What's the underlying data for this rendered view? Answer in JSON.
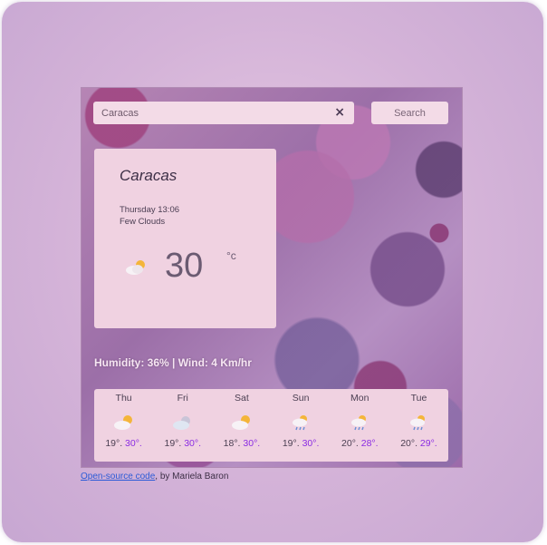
{
  "search": {
    "value": "Caracas",
    "clear_label": "×",
    "button_label": "Search"
  },
  "current": {
    "city": "Caracas",
    "datetime": "Thursday 13:06",
    "description": "Few Clouds",
    "icon": "few-clouds-icon",
    "temperature": "30",
    "unit": "°c"
  },
  "conditions": {
    "text": "Humidity: 36% | Wind: 4 Km/hr"
  },
  "forecast": [
    {
      "day": "Thu",
      "icon": "few-clouds-icon",
      "min": "19°.",
      "max": "30°."
    },
    {
      "day": "Fri",
      "icon": "cloudy-icon",
      "min": "19°.",
      "max": "30°."
    },
    {
      "day": "Sat",
      "icon": "few-clouds-icon",
      "min": "18°.",
      "max": "30°."
    },
    {
      "day": "Sun",
      "icon": "rain-icon",
      "min": "19°.",
      "max": "30°."
    },
    {
      "day": "Mon",
      "icon": "rain-icon",
      "min": "20°.",
      "max": "28°."
    },
    {
      "day": "Tue",
      "icon": "rain-icon",
      "min": "20°.",
      "max": "29°."
    }
  ],
  "footer": {
    "link_text": "Open-source code",
    "suffix": ", by Mariela Baron"
  },
  "colors": {
    "max_temp": "#8a2be2",
    "link": "#2b5bd7",
    "card": "#f0d2e1"
  }
}
